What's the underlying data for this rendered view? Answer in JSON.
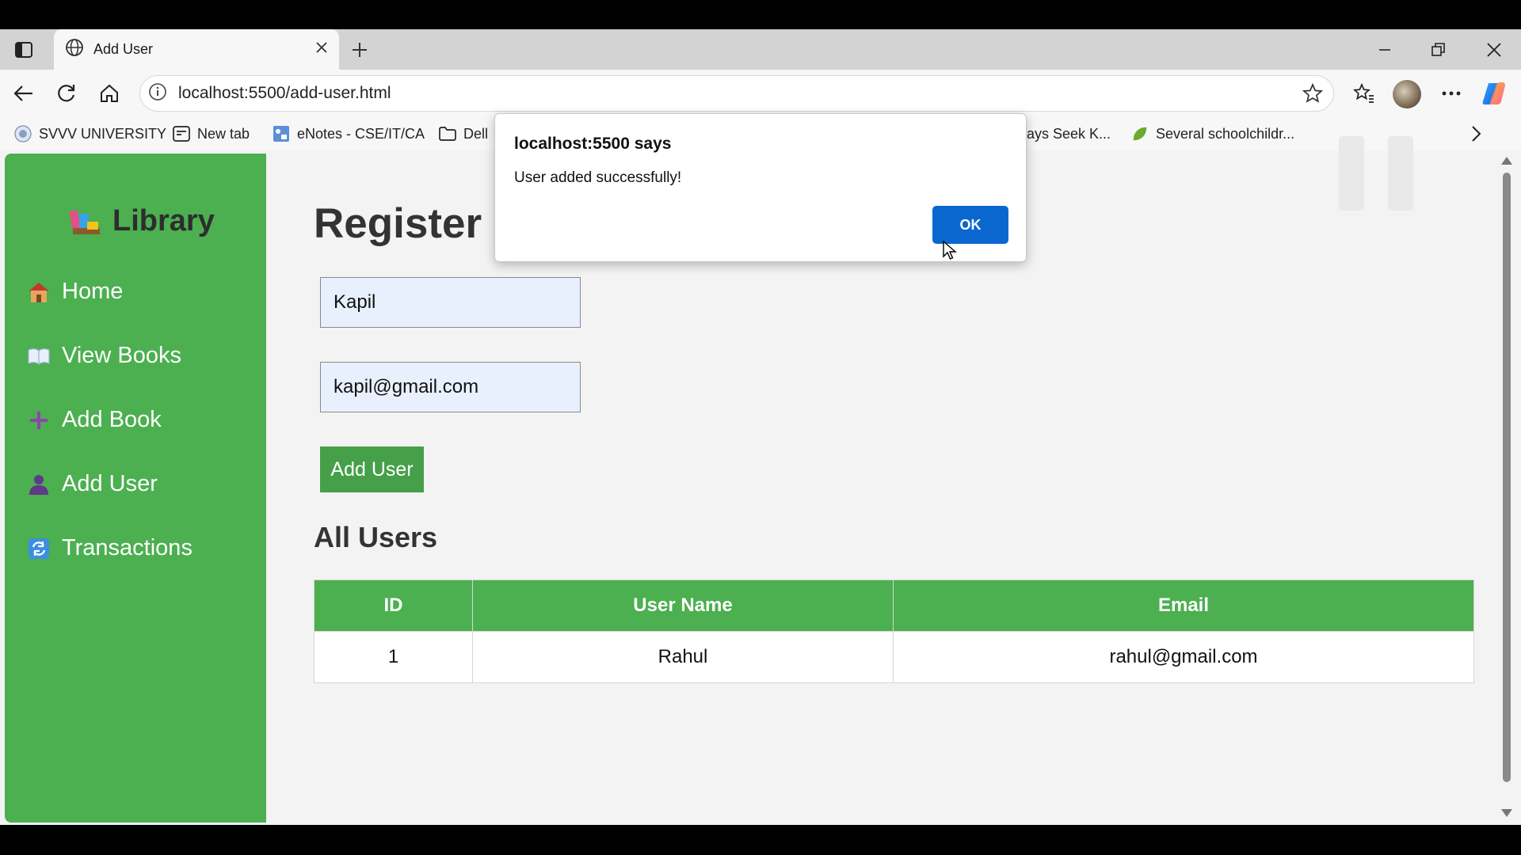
{
  "browser": {
    "tab_title": "Add User",
    "url": "localhost:5500/add-user.html",
    "bookmarks": [
      {
        "label": "SVVV UNIVERSITY"
      },
      {
        "label": "New tab"
      },
      {
        "label": "eNotes - CSE/IT/CA"
      },
      {
        "label": "Dell"
      },
      {
        "label": "ays Seek K..."
      },
      {
        "label": "Several schoolchildr..."
      }
    ]
  },
  "sidebar": {
    "logo": "Library",
    "items": [
      {
        "label": "Home"
      },
      {
        "label": "View Books"
      },
      {
        "label": "Add Book"
      },
      {
        "label": "Add User"
      },
      {
        "label": "Transactions"
      }
    ]
  },
  "main": {
    "title": "Register New User",
    "name_value": "Kapil",
    "email_value": "kapil@gmail.com",
    "add_button": "Add User",
    "section_title": "All Users",
    "table": {
      "headers": [
        "ID",
        "User Name",
        "Email"
      ],
      "rows": [
        [
          "1",
          "Rahul",
          "rahul@gmail.com"
        ]
      ]
    }
  },
  "dialog": {
    "title": "localhost:5500 says",
    "message": "User added successfully!",
    "ok_label": "OK"
  }
}
